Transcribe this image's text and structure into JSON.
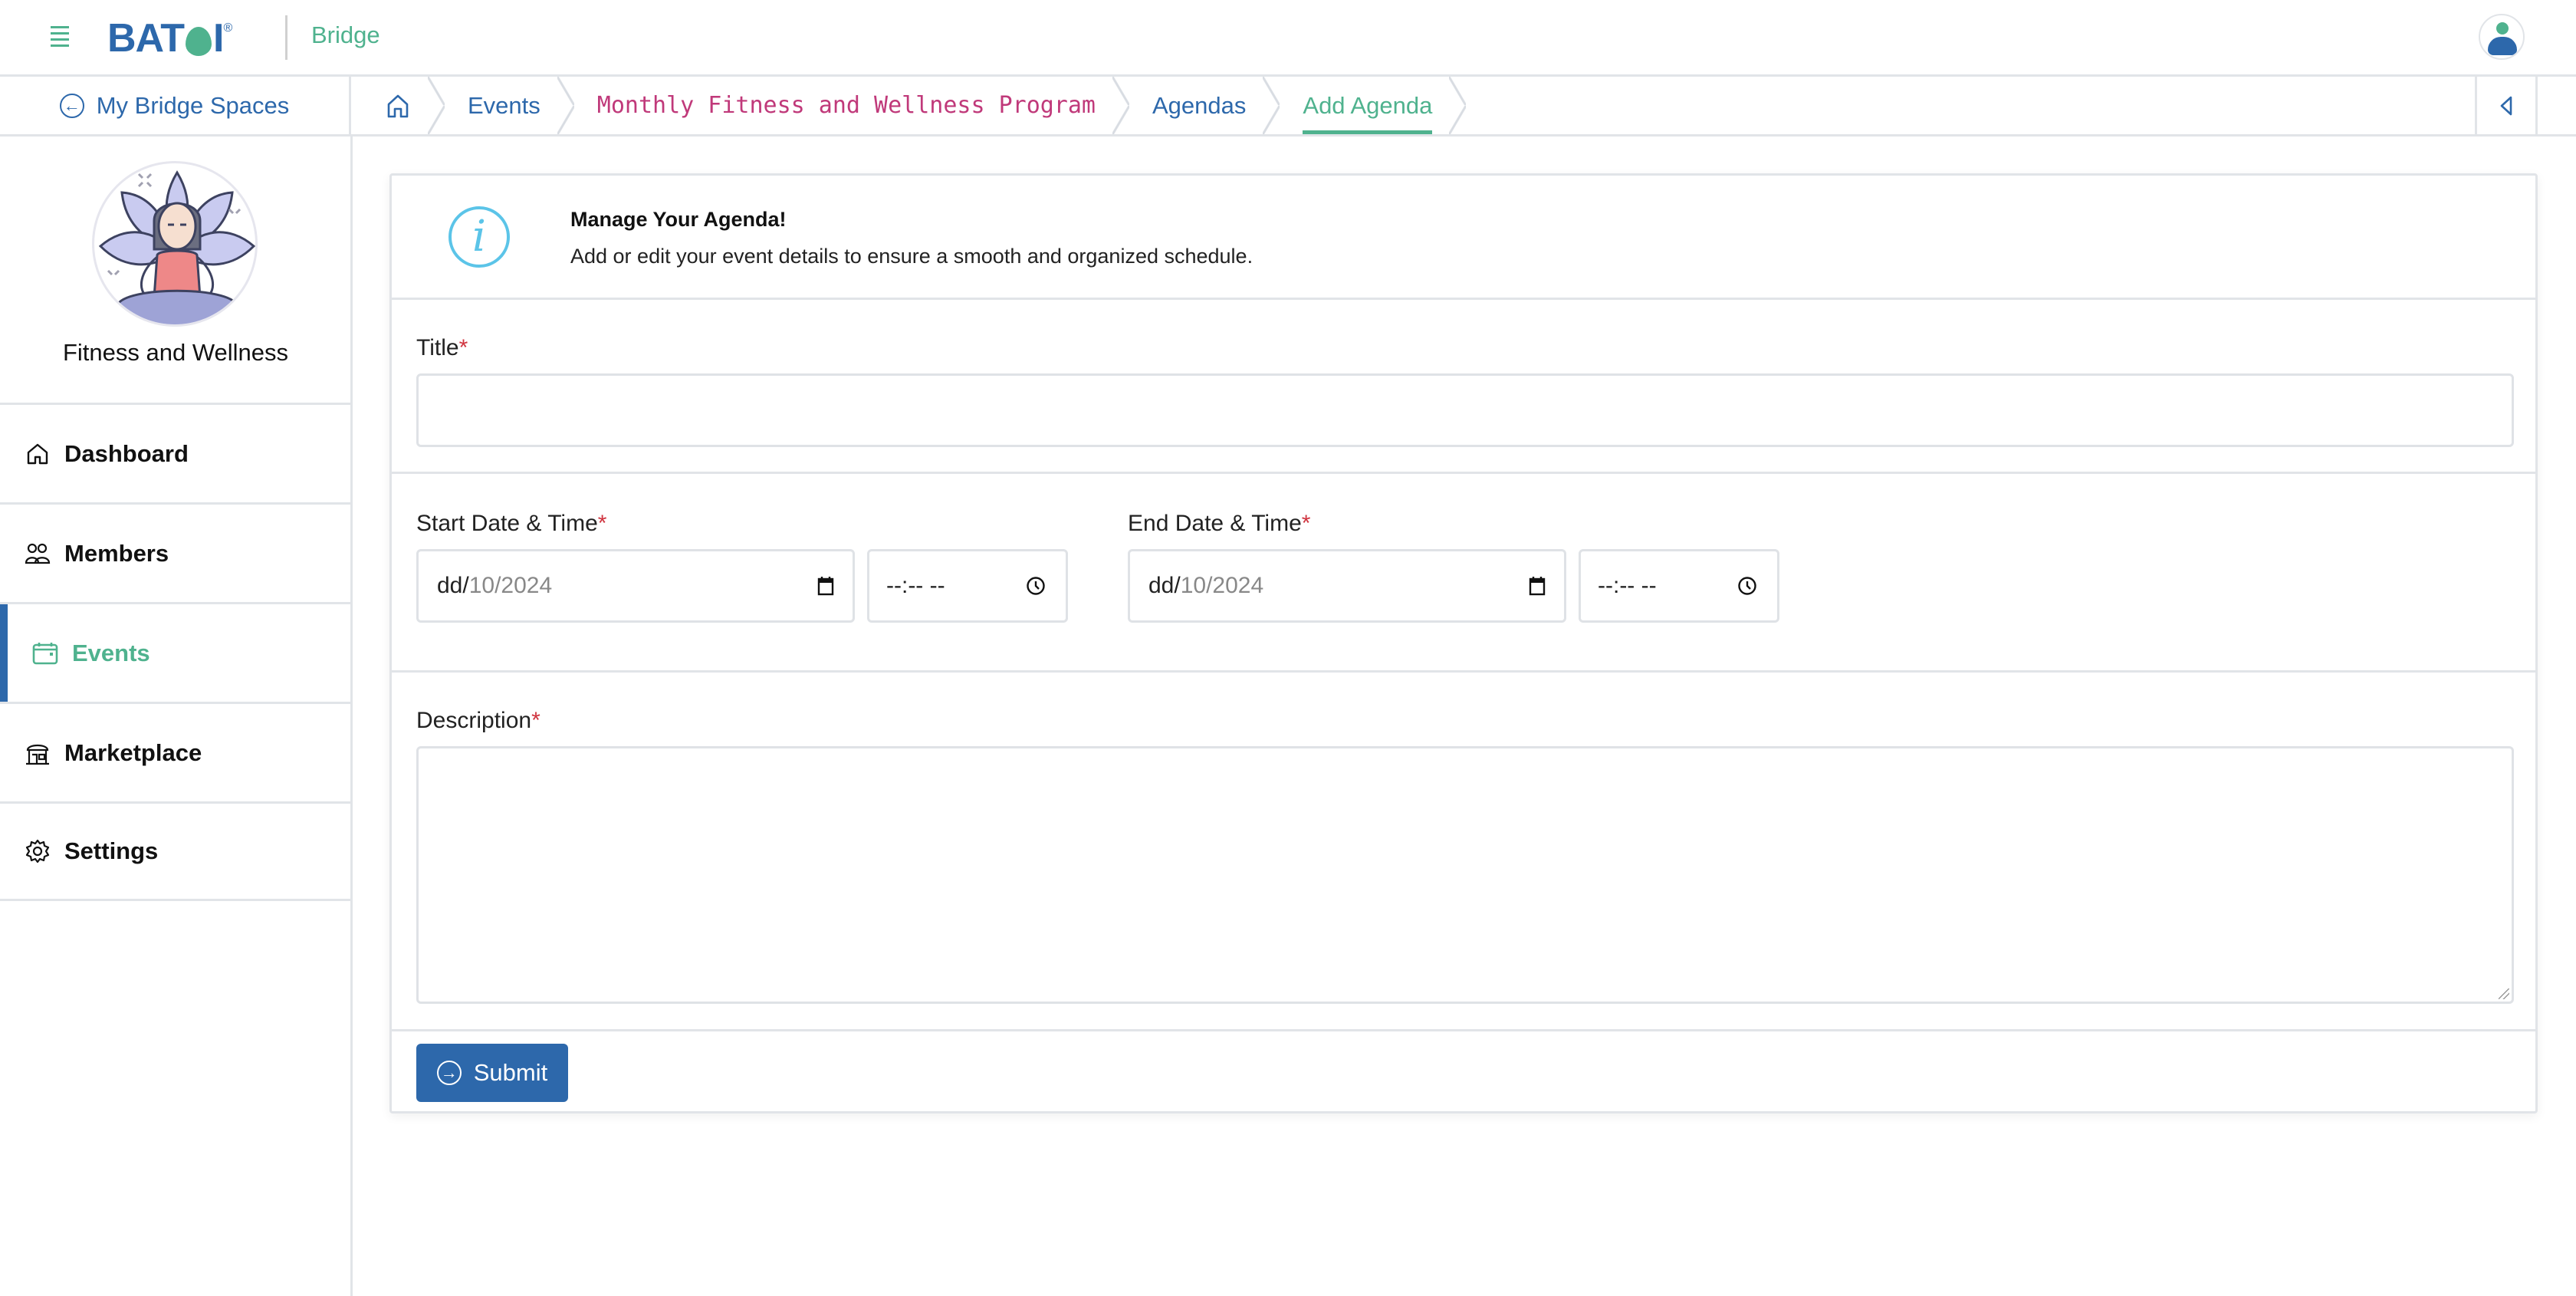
{
  "header": {
    "logo_text": "BATOI",
    "logo_registered": "®",
    "app_name": "Bridge",
    "brand_colors": {
      "primary": "#2d68ab",
      "accent": "#4fb28e"
    }
  },
  "breadcrumb_bar": {
    "back_label": "My Bridge Spaces",
    "items": [
      {
        "label": "",
        "icon": "home-icon"
      },
      {
        "label": "Events"
      },
      {
        "label": "Monthly Fitness and Wellness Program"
      },
      {
        "label": "Agendas"
      },
      {
        "label": "Add Agenda",
        "active": true
      }
    ],
    "collapse_icon": "triangle-left-icon"
  },
  "sidebar": {
    "space_name": "Fitness and Wellness",
    "space_avatar": "yoga-meditation-illustration",
    "items": [
      {
        "label": "Dashboard",
        "icon": "home-icon"
      },
      {
        "label": "Members",
        "icon": "users-icon"
      },
      {
        "label": "Events",
        "icon": "calendar-icon",
        "active": true
      },
      {
        "label": "Marketplace",
        "icon": "store-icon"
      },
      {
        "label": "Settings",
        "icon": "gear-icon"
      }
    ]
  },
  "form": {
    "info": {
      "icon": "info-icon",
      "title": "Manage Your Agenda!",
      "text": "Add or edit your event details to ensure a smooth and organized schedule."
    },
    "title_label": "Title",
    "title_value": "",
    "required_mark": "*",
    "start_label": "Start Date & Time",
    "end_label": "End Date & Time",
    "start_date": {
      "dd": "dd/",
      "rest": "10/2024"
    },
    "start_time": "--:-- --",
    "end_date": {
      "dd": "dd/",
      "rest": "10/2024"
    },
    "end_time": "--:-- --",
    "description_label": "Description",
    "description_value": "",
    "submit_label": "Submit"
  }
}
